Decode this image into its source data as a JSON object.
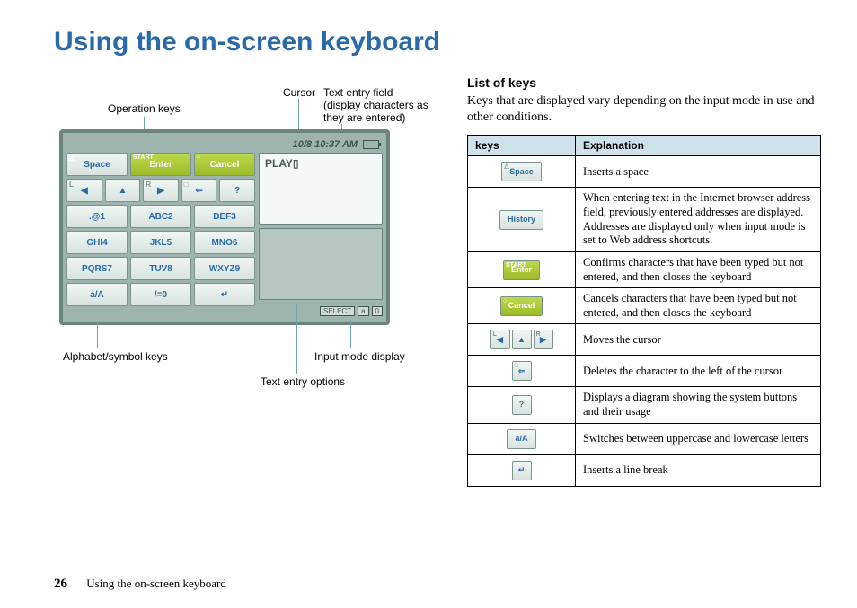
{
  "page": {
    "title": "Using the on-screen keyboard",
    "number": "26",
    "footer_title": "Using the on-screen keyboard"
  },
  "callouts": {
    "operation_keys": "Operation keys",
    "cursor": "Cursor",
    "text_entry_field": "Text entry field",
    "text_entry_field_sub": "(display characters as they are entered)",
    "alphabet_symbol_keys": "Alphabet/symbol keys",
    "input_mode_display": "Input mode display",
    "text_entry_options": "Text entry options"
  },
  "device": {
    "status_time": "10/8 10:37 AM",
    "entered_text": "PLAY",
    "mode_chips": [
      "SELECT",
      "a",
      "0"
    ],
    "rows": {
      "top": [
        "Space",
        "Enter",
        "Cancel"
      ],
      "nav": [
        "◀",
        "▲",
        "▶",
        "⇐",
        "?"
      ],
      "r1": [
        ".@1",
        "ABC2",
        "DEF3"
      ],
      "r2": [
        "GHI4",
        "JKL5",
        "MNO6"
      ],
      "r3": [
        "PQRS7",
        "TUV8",
        "WXYZ9"
      ],
      "r4": [
        "a/A",
        "/=0",
        "↵"
      ]
    },
    "top_corners": [
      "△",
      "START",
      "○"
    ],
    "nav_corners": [
      "L",
      "",
      "R",
      "□",
      ""
    ]
  },
  "right": {
    "subheading": "List of keys",
    "intro": "Keys that are displayed vary depending on the input mode in use and other conditions.",
    "table": {
      "headers": [
        "keys",
        "Explanation"
      ],
      "rows": [
        {
          "key_label": "Space",
          "key_style": "normal",
          "corner": "△",
          "explanation": "Inserts a space"
        },
        {
          "key_label": "History",
          "key_style": "normal",
          "corner": "",
          "explanation": "When entering text in the Internet browser address field, previously entered addresses are displayed. Addresses are displayed only when input mode is set to Web address shortcuts."
        },
        {
          "key_label": "Enter",
          "key_style": "green",
          "corner": "START",
          "explanation": "Confirms characters that have been typed but not entered, and then closes the keyboard"
        },
        {
          "key_label": "Cancel",
          "key_style": "green",
          "corner": "○",
          "explanation": "Cancels characters that have been typed but not entered, and then closes the keyboard"
        },
        {
          "key_label": "arrows",
          "key_style": "arrows",
          "explanation": "Moves the cursor"
        },
        {
          "key_label": "⇐",
          "key_style": "sq",
          "corner": "□",
          "explanation": "Deletes the character to the left of the cursor"
        },
        {
          "key_label": "?",
          "key_style": "sq",
          "explanation": "Displays a diagram showing the system buttons and their usage"
        },
        {
          "key_label": "a/A",
          "key_style": "normal",
          "explanation": "Switches between uppercase and lowercase letters"
        },
        {
          "key_label": "↵",
          "key_style": "sq",
          "explanation": "Inserts a line break"
        }
      ]
    }
  }
}
